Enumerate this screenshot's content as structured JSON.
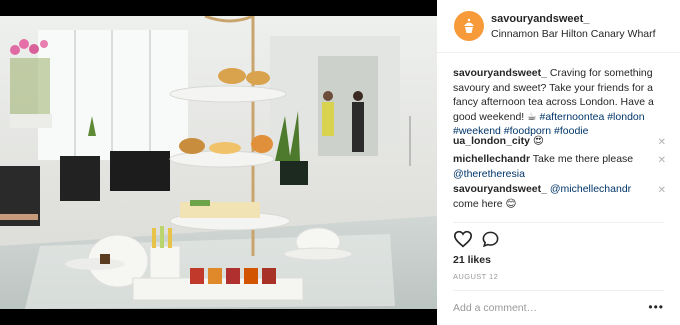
{
  "post": {
    "username": "savouryandsweet_",
    "location": "Cinnamon Bar Hilton Canary Wharf",
    "caption_user": "savouryandsweet_",
    "caption_text": " Craving for something savoury and sweet? Take your friends for a fancy afternoon tea across London. Have a good weekend! ☕ ",
    "hashtags": [
      "#afternoontea",
      "#london",
      "#weekend",
      "#foodporn",
      "#foodie"
    ],
    "comments": [
      {
        "user": "ua_london_city",
        "text": " 😍"
      },
      {
        "user": "michellechandr",
        "text": " Take me there please ",
        "mention": "@theretheresia"
      },
      {
        "user": "savouryandsweet_",
        "mention_first": " @michellechandr",
        "text": " come here 😊"
      }
    ],
    "likes": "21 likes",
    "date": "AUGUST 12",
    "comment_placeholder": "Add a comment…",
    "more_label": "•••"
  },
  "icons": {
    "logo": "cupcake-logo-icon",
    "like": "heart-icon",
    "comment": "speech-bubble-icon",
    "remove": "close-icon"
  },
  "colors": {
    "avatar": "#f79a3a",
    "link": "#003569",
    "muted": "#999999"
  }
}
